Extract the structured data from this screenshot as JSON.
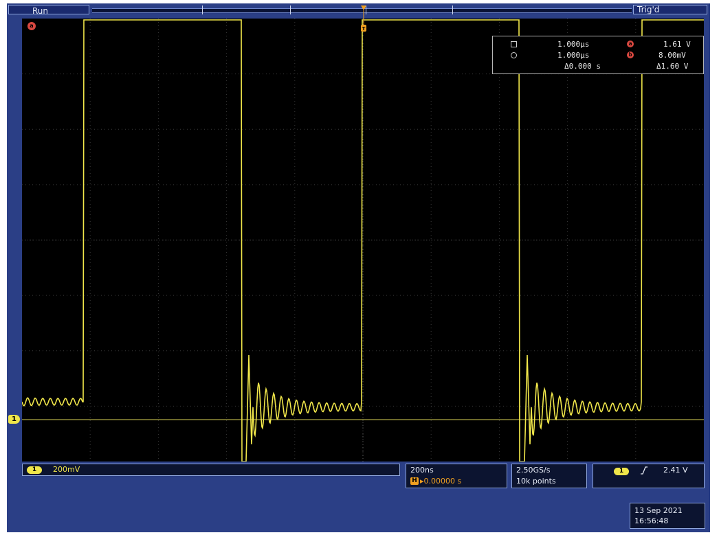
{
  "status": {
    "run_label": "Run",
    "trigger_state": "Trig'd"
  },
  "cursors": {
    "time_a": "1.000µs",
    "time_b": "1.000µs",
    "time_delta": "Δ0.000 s",
    "volt_a": "1.61 V",
    "volt_b": "8.00mV",
    "volt_delta": "Δ1.60 V",
    "marker_a": "a",
    "marker_b": "b"
  },
  "channel1": {
    "badge": "1",
    "scale": "200mV",
    "trace_color": "#f0e64a"
  },
  "horizontal": {
    "time_per_div": "200ns",
    "position_badge": "H",
    "position": "▸0.00000 s"
  },
  "acquisition": {
    "sample_rate": "2.50GS/s",
    "record_length": "10k points"
  },
  "trigger": {
    "source_badge": "1",
    "slope_icon": "rising-edge-icon",
    "level": "2.41 V"
  },
  "datetime": {
    "date": "13 Sep  2021",
    "time": "16:56:48"
  },
  "colors": {
    "frame": "#2b3f86",
    "screen": "#000000",
    "trace": "#f0e64a",
    "ground_line": "#d8d254",
    "cursor_marker": "#d84840",
    "position_marker": "#f0a020"
  }
}
